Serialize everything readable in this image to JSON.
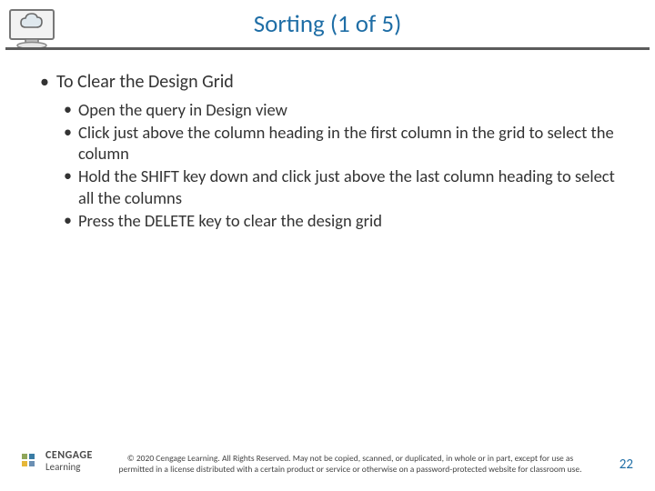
{
  "title": "Sorting (1 of 5)",
  "heading": "To Clear the Design Grid",
  "steps": [
    "Open the query in Design view",
    "Click just above the column heading in the first column in the grid to select the column",
    "Hold the SHIFT key down and click just above the last column heading to select all the columns",
    "Press the DELETE key to clear the design grid"
  ],
  "brand": {
    "name": "CENGAGE",
    "sub": "Learning"
  },
  "copyright": "© 2020 Cengage Learning. All Rights Reserved. May not be copied, scanned, or duplicated, in whole or in part, except for use as permitted in a license distributed with a certain product or service or otherwise on a password-protected website for classroom use.",
  "page": "22"
}
